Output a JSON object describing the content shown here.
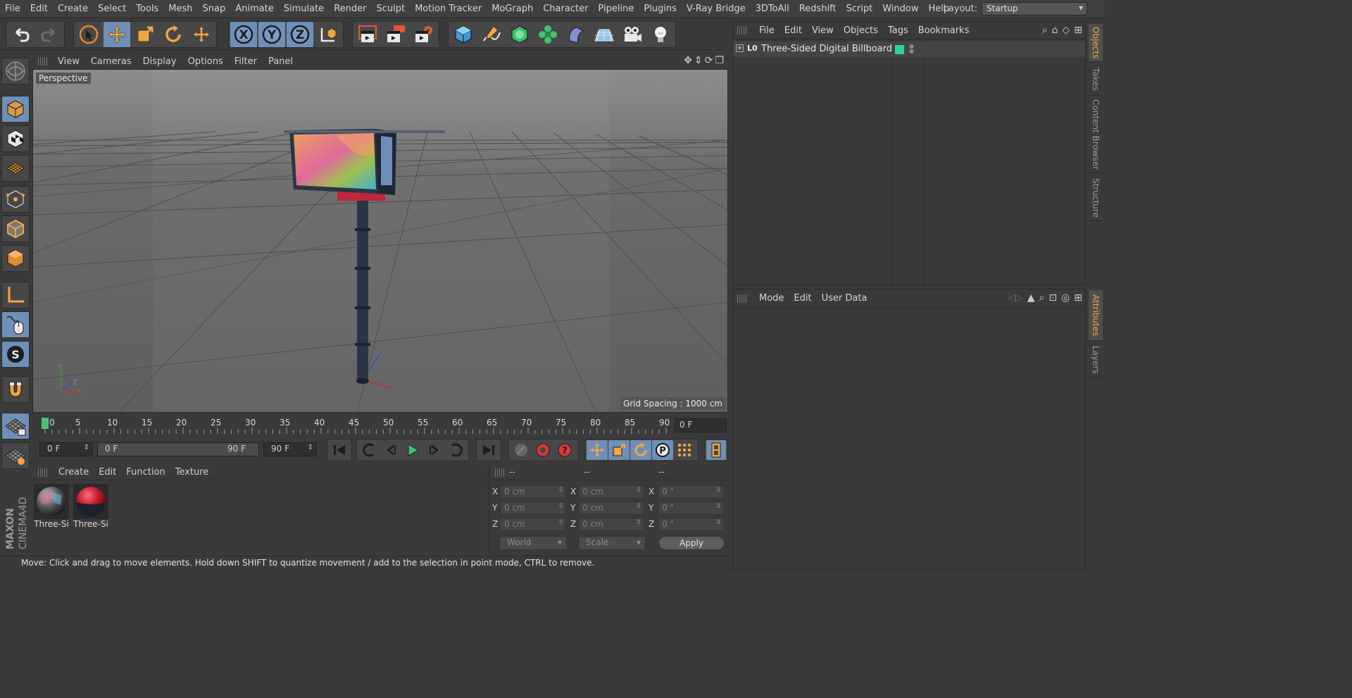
{
  "menu": [
    "File",
    "Edit",
    "Create",
    "Select",
    "Tools",
    "Mesh",
    "Snap",
    "Animate",
    "Simulate",
    "Render",
    "Sculpt",
    "Motion Tracker",
    "MoGraph",
    "Character",
    "Pipeline",
    "Plugins",
    "V-Ray Bridge",
    "3DToAll",
    "Redshift",
    "Script",
    "Window",
    "Help"
  ],
  "layout": {
    "label": "Layout:",
    "value": "Startup"
  },
  "viewport": {
    "menu": [
      "View",
      "Cameras",
      "Display",
      "Options",
      "Filter",
      "Panel"
    ],
    "label": "Perspective",
    "grid_spacing": "Grid Spacing : 1000 cm",
    "axis": {
      "y": "Y",
      "z": "Z",
      "x": "X"
    }
  },
  "timeline": {
    "ticks": [
      "0",
      "5",
      "10",
      "15",
      "20",
      "25",
      "30",
      "35",
      "40",
      "45",
      "50",
      "55",
      "60",
      "65",
      "70",
      "75",
      "80",
      "85",
      "90"
    ],
    "current_frame": "0 F",
    "start": "0 F",
    "range_start": "0 F",
    "range_end": "90 F",
    "end": "90 F"
  },
  "materials": {
    "menu": [
      "Create",
      "Edit",
      "Function",
      "Texture"
    ],
    "items": [
      {
        "name": "Three-Si"
      },
      {
        "name": "Three-Si"
      }
    ]
  },
  "coordinates": {
    "headers": [
      "--",
      "--",
      "--"
    ],
    "rows": [
      {
        "axis": "X",
        "pos": "0 cm",
        "size": "0 cm",
        "rot": "0 °"
      },
      {
        "axis": "Y",
        "pos": "0 cm",
        "size": "0 cm",
        "rot": "0 °"
      },
      {
        "axis": "Z",
        "pos": "0 cm",
        "size": "0 cm",
        "rot": "0 °"
      }
    ],
    "mode": "World",
    "scale": "Scale",
    "apply": "Apply"
  },
  "objects": {
    "menu": [
      "File",
      "Edit",
      "View",
      "Objects",
      "Tags",
      "Bookmarks"
    ],
    "item": {
      "icon": "L0",
      "name": "Three-Sided Digital Billboard x",
      "tag_color": "#2ed39a"
    }
  },
  "attributes": {
    "menu": [
      "Mode",
      "Edit",
      "User Data"
    ]
  },
  "side_tabs_top": [
    "Objects",
    "Takes",
    "Content Browser",
    "Structure"
  ],
  "side_tabs_bottom": [
    "Attributes",
    "Layers"
  ],
  "status": "Move: Click and drag to move elements. Hold down SHIFT to quantize movement / add to the selection in point mode, CTRL to remove.",
  "logo": {
    "line1": "MAXON",
    "line2": "CINEMA4D"
  },
  "colors": {
    "accent": "#6e8fb7",
    "tab_active": "#f0a640"
  }
}
